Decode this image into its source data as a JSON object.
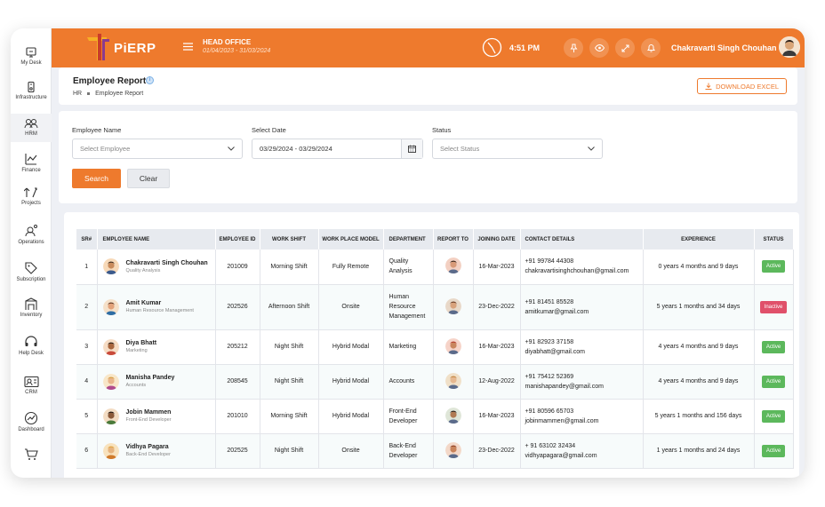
{
  "sidebar": {
    "items": [
      {
        "label": "My Desk",
        "icon": "desk-icon"
      },
      {
        "label": "Infrastructure",
        "icon": "infrastructure-icon"
      },
      {
        "label": "HRM",
        "icon": "hrm-icon"
      },
      {
        "label": "Finance",
        "icon": "finance-icon"
      },
      {
        "label": "Projects",
        "icon": "projects-icon"
      },
      {
        "label": "Operations",
        "icon": "operations-icon"
      },
      {
        "label": "Subscription",
        "icon": "subscription-icon"
      },
      {
        "label": "Inventory",
        "icon": "inventory-icon"
      },
      {
        "label": "Help Desk",
        "icon": "help-desk-icon"
      },
      {
        "label": "CRM",
        "icon": "crm-icon"
      },
      {
        "label": "Dashboard",
        "icon": "dashboard-icon"
      },
      {
        "label": "",
        "icon": "cart-icon"
      }
    ]
  },
  "topbar": {
    "logo_text": "PiERP",
    "office_title": "HEAD OFFICE",
    "office_period": "01/04/2023 - 31/03/2024",
    "time": "4:51 PM",
    "user_name": "Chakravarti Singh Chouhan",
    "accent_color": "#ee7a2d"
  },
  "header": {
    "title": "Employee Report",
    "info_glyph": "i",
    "breadcrumb_root": "HR",
    "breadcrumb_current": "Employee Report",
    "download_label": "DOWNLOAD EXCEL"
  },
  "filters": {
    "employee_label": "Employee Name",
    "employee_placeholder": "Select Employee",
    "date_label": "Select Date",
    "date_value": "03/29/2024 - 03/29/2024",
    "status_label": "Status",
    "status_placeholder": "Select Status",
    "search_label": "Search",
    "clear_label": "Clear"
  },
  "table": {
    "headers": [
      "SR#",
      "EMPLOYEE NAME",
      "EMPLOYEE ID",
      "WORK SHIFT",
      "WORK PLACE MODEL",
      "DEPARTMENT",
      "REPORT TO",
      "JOINING DATE",
      "CONTACT DETAILS",
      "EXPERIENCE",
      "STATUS"
    ],
    "rows": [
      {
        "sr": "1",
        "name": "Chakravarti Singh Chouhan",
        "designation": "Quality Analysis",
        "emp_id": "201009",
        "shift": "Morning Shift",
        "model": "Fully Remote",
        "dept": "Quality Analysis",
        "joining": "16-Mar-2023",
        "phone": "+91 99784 44308",
        "email": "chakravartisinghchouhan@gmail.com",
        "experience": "0 years 4 months and 9 days",
        "status": "Active"
      },
      {
        "sr": "2",
        "name": "Amit Kumar",
        "designation": "Human Resource Management",
        "emp_id": "202526",
        "shift": "Afternoon Shift",
        "model": "Onsite",
        "dept": "Human Resource Management",
        "joining": "23-Dec-2022",
        "phone": "+91 81451 85528",
        "email": "amitkumar@gmail.com",
        "experience": "5 years 1 months and 34 days",
        "status": "Inactive"
      },
      {
        "sr": "3",
        "name": "Diya Bhatt",
        "designation": "Marketing",
        "emp_id": "205212",
        "shift": "Night Shift",
        "model": "Hybrid Modal",
        "dept": "Marketing",
        "joining": "16-Mar-2023",
        "phone": "+91 82923 37158",
        "email": "diyabhatt@gmail.com",
        "experience": "4 years 4 months and 9 days",
        "status": "Active"
      },
      {
        "sr": "4",
        "name": "Manisha Pandey",
        "designation": "Accounts",
        "emp_id": "208545",
        "shift": "Night Shift",
        "model": "Hybrid Modal",
        "dept": "Accounts",
        "joining": "12-Aug-2022",
        "phone": "+91 75412 52369",
        "email": "manishapandey@gmail.com",
        "experience": "4 years 4 months and 9 days",
        "status": "Active"
      },
      {
        "sr": "5",
        "name": "Jobin Mammen",
        "designation": "Front-End Developer",
        "emp_id": "201010",
        "shift": "Morning Shift",
        "model": "Hybrid Modal",
        "dept": "Front-End Developer",
        "joining": "16-Mar-2023",
        "phone": "+91 80596 65703",
        "email": "jobinmammen@gmail.com",
        "experience": "5 years 1 months and 156 days",
        "status": "Active"
      },
      {
        "sr": "6",
        "name": "Vidhya Pagara",
        "designation": "Back-End Developer",
        "emp_id": "202525",
        "shift": "Night Shift",
        "model": "Onsite",
        "dept": "Back-End Developer",
        "joining": "23-Dec-2022",
        "phone": "+ 91 63102 32434",
        "email": "vidhyapagara@gmail.com",
        "experience": "1 years 1 months and 24 days",
        "status": "Active"
      }
    ]
  }
}
